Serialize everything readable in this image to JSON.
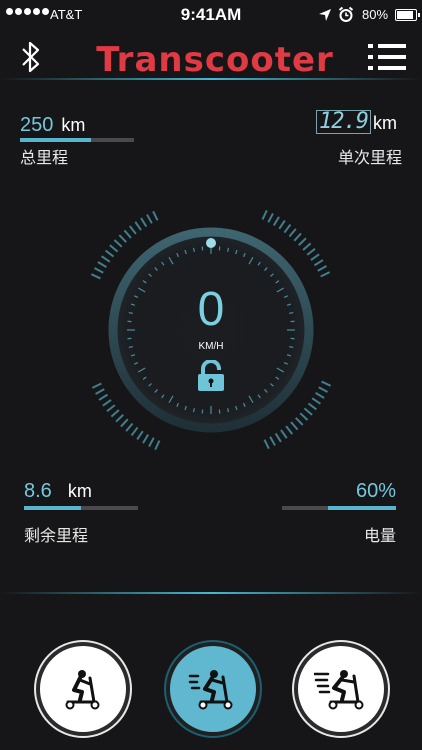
{
  "status_bar": {
    "carrier": "AT&T",
    "time": "9:41AM",
    "battery": "80%"
  },
  "header": {
    "title": "Transcooter",
    "icons": [
      "bluetooth-icon",
      "menu-icon"
    ]
  },
  "total_mileage": {
    "value": "250",
    "unit": "km",
    "label": "总里程",
    "progress": 0.62
  },
  "trip_mileage": {
    "value": "12.9",
    "unit": "km",
    "label": "单次里程"
  },
  "speedometer": {
    "speed": "0",
    "unit": "KM/H",
    "lock_icon": "unlock-icon"
  },
  "remaining_range": {
    "value": "8.6",
    "unit": "km",
    "label": "剩余里程",
    "progress": 0.5
  },
  "battery_level": {
    "value": "60%",
    "label": "电量",
    "progress": 0.6
  },
  "modes": [
    {
      "icon": "scooter-slow-icon",
      "active": false
    },
    {
      "icon": "scooter-medium-icon",
      "active": true
    },
    {
      "icon": "scooter-fast-icon",
      "active": false
    }
  ],
  "colors": {
    "accent": "#5fb8cf",
    "title_red": "#e03a45",
    "background": "#161618"
  }
}
